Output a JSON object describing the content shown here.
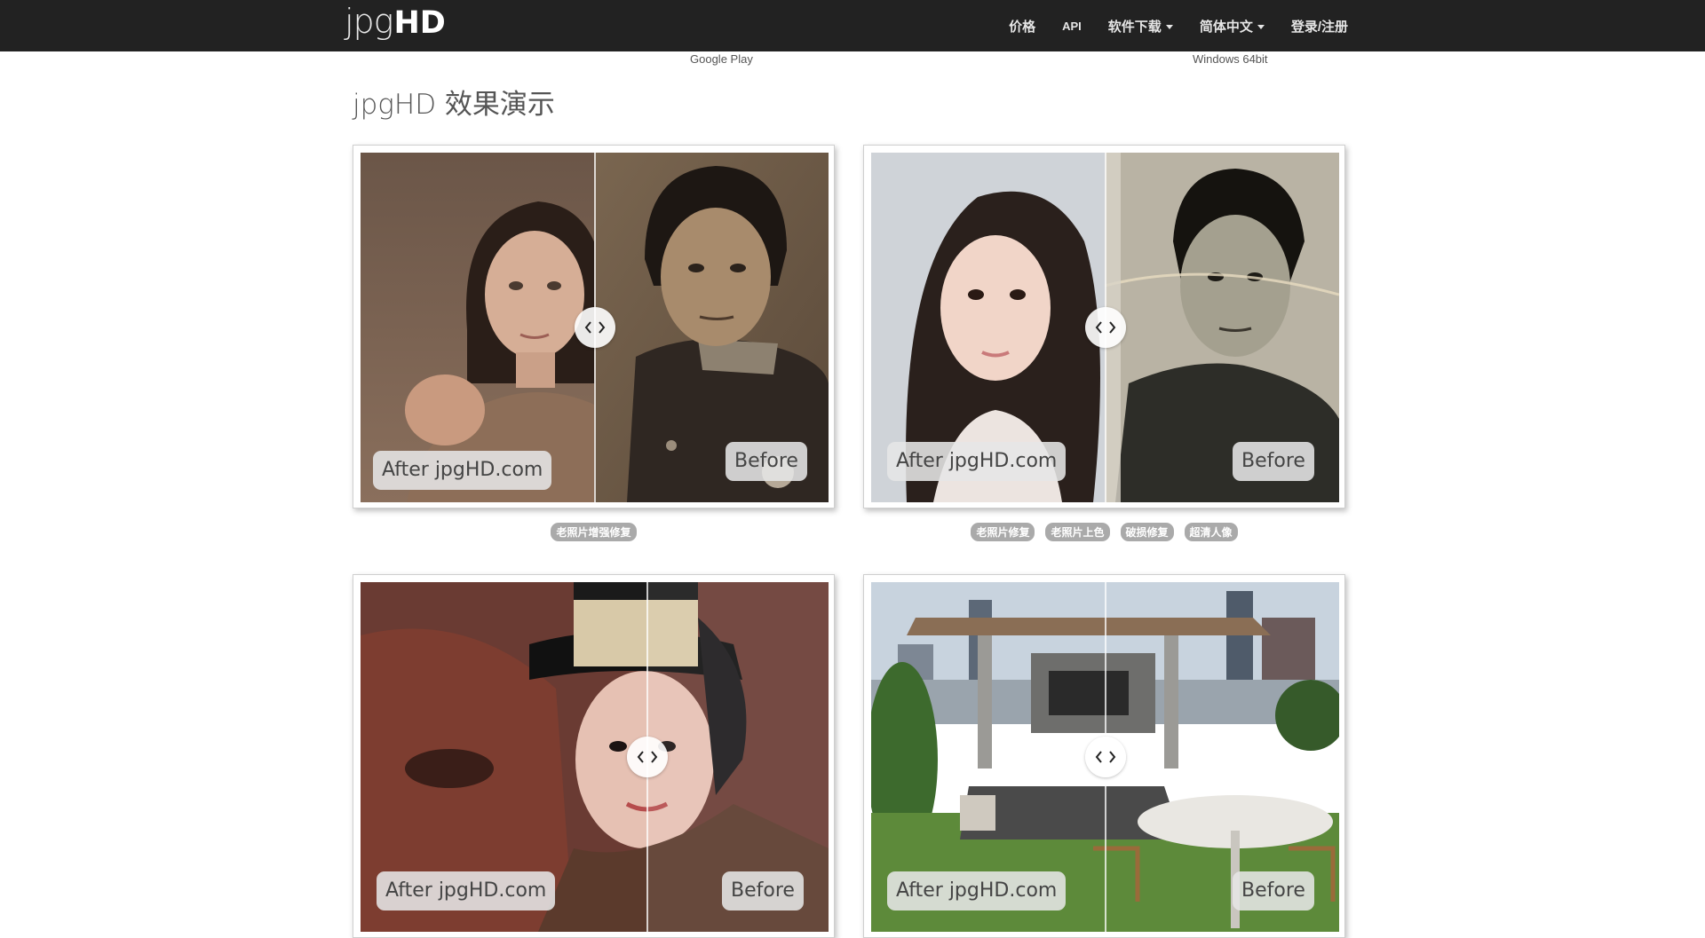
{
  "nav": {
    "brand_light": "jpg",
    "brand_bold": "HD",
    "items": [
      {
        "label": "价格"
      },
      {
        "label": "API"
      },
      {
        "label": "软件下载"
      },
      {
        "label": "简体中文"
      },
      {
        "label": "登录/注册"
      }
    ]
  },
  "downloads": {
    "google_play": "Google Play",
    "windows": "Windows 64bit"
  },
  "page_title": "jpgHD 效果演示",
  "demos": [
    {
      "after_label": "After jpgHD.com",
      "before_label": "Before",
      "tags": [
        "老照片增强修复"
      ]
    },
    {
      "after_label": "After jpgHD.com",
      "before_label": "Before",
      "tags": [
        "老照片修复",
        "老照片上色",
        "破损修复",
        "超清人像"
      ]
    },
    {
      "after_label": "After jpgHD.com",
      "before_label": "Before",
      "tags": []
    },
    {
      "after_label": "After jpgHD.com",
      "before_label": "Before",
      "tags": []
    }
  ],
  "colors": {
    "navbar": "#222222",
    "tag_bg": "#aaaaaa"
  },
  "icons": {
    "slider_handle": "chevron-left-right-icon",
    "dropdown": "caret-down-icon"
  }
}
